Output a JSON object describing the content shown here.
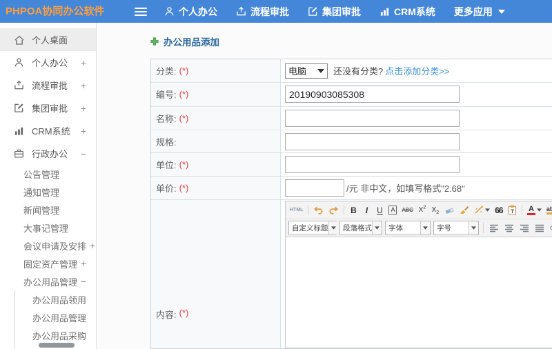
{
  "topbar": {
    "logo": "PHPOA协同办公软件",
    "nav": [
      {
        "id": "personal-office",
        "label": "个人办公",
        "icon": "user-icon"
      },
      {
        "id": "workflow-approval",
        "label": "流程审批",
        "icon": "flow-icon"
      },
      {
        "id": "group-approval",
        "label": "集团审批",
        "icon": "edit-icon"
      },
      {
        "id": "crm-system",
        "label": "CRM系统",
        "icon": "chart-icon"
      },
      {
        "id": "more-apps",
        "label": "更多应用",
        "icon": null,
        "caret": true
      }
    ]
  },
  "sidebar": {
    "items": [
      {
        "id": "personal-desktop",
        "label": "个人桌面",
        "icon": "home-icon",
        "level": 1,
        "active": true
      },
      {
        "id": "personal-office",
        "label": "个人办公",
        "icon": "user-icon",
        "level": 1,
        "toggle": "+"
      },
      {
        "id": "workflow-approval",
        "label": "流程审批",
        "icon": "flow-icon",
        "level": 1,
        "toggle": "+"
      },
      {
        "id": "group-approval",
        "label": "集团审批",
        "icon": "edit-icon",
        "level": 1,
        "toggle": "+"
      },
      {
        "id": "crm-system",
        "label": "CRM系统",
        "icon": "chart-icon",
        "level": 1,
        "toggle": "+"
      },
      {
        "id": "admin-office",
        "label": "行政办公",
        "icon": "briefcase-icon",
        "level": 1,
        "toggle": "−"
      },
      {
        "id": "announcement-mgmt",
        "label": "公告管理",
        "level": 2
      },
      {
        "id": "notice-mgmt",
        "label": "通知管理",
        "level": 2
      },
      {
        "id": "news-mgmt",
        "label": "新闻管理",
        "level": 2
      },
      {
        "id": "memorabilia-mgmt",
        "label": "大事记管理",
        "level": 2
      },
      {
        "id": "meeting-request",
        "label": "会议申请及安排",
        "level": 2,
        "toggle": "+",
        "toggle_inline": true
      },
      {
        "id": "fixed-assets-mgmt",
        "label": "固定资产管理",
        "level": 2,
        "toggle": "+",
        "toggle_inline": true
      },
      {
        "id": "office-supplies-mgmt",
        "label": "办公用品管理",
        "level": 2,
        "toggle": "−",
        "toggle_inline": true
      },
      {
        "id": "office-supplies-receive",
        "label": "办公用品领用",
        "level": 3
      },
      {
        "id": "office-supplies-manage",
        "label": "办公用品管理",
        "level": 3
      },
      {
        "id": "office-supplies-purchase",
        "label": "办公用品采购",
        "level": 3
      }
    ]
  },
  "main": {
    "title": "办公用品添加"
  },
  "form": {
    "rows": [
      {
        "id": "category",
        "label": "分类:",
        "required": "(*)",
        "type": "select",
        "value": "电脑",
        "note": "还没有分类?",
        "link": "点击添加分类>>"
      },
      {
        "id": "code",
        "label": "编号:",
        "required": "(*)",
        "type": "text",
        "value": "20190903085308"
      },
      {
        "id": "name",
        "label": "名称:",
        "required": "(*)",
        "type": "text",
        "value": ""
      },
      {
        "id": "spec",
        "label": "规格:",
        "required": "",
        "type": "text",
        "value": ""
      },
      {
        "id": "unit",
        "label": "单位:",
        "required": "(*)",
        "type": "text",
        "value": ""
      },
      {
        "id": "price",
        "label": "单价:",
        "required": "(*)",
        "type": "price",
        "value": "",
        "note": "/元 非中文，如填写格式\"2.68\""
      },
      {
        "id": "content",
        "label": "内容:",
        "required": "(*)",
        "type": "editor",
        "value": ""
      }
    ]
  },
  "editor": {
    "toolbar_row1": [
      "html-source",
      "separator",
      "undo",
      "redo",
      "separator",
      "bold",
      "italic",
      "underline",
      "char-border",
      "strikethrough",
      "superscript",
      "subscript",
      "eraser",
      "format-brush",
      "auto-format",
      "blockquote",
      "paste-as-text",
      "separator",
      "font-color",
      "background-color"
    ],
    "toolbar_row2_dropdowns": [
      "自定义标题",
      "段落格式",
      "字体",
      "字号"
    ],
    "toolbar_row2_buttons": [
      "align-left",
      "align-center",
      "align-right",
      "align-justify",
      "link"
    ]
  },
  "colors": {
    "topbar_bg": "#4486d7",
    "logo_orange": "#ff9f3d",
    "title_blue": "#2a669c",
    "link_blue": "#3a8fd8",
    "required_red": "#e53c3c",
    "add_green": "#62b862"
  }
}
